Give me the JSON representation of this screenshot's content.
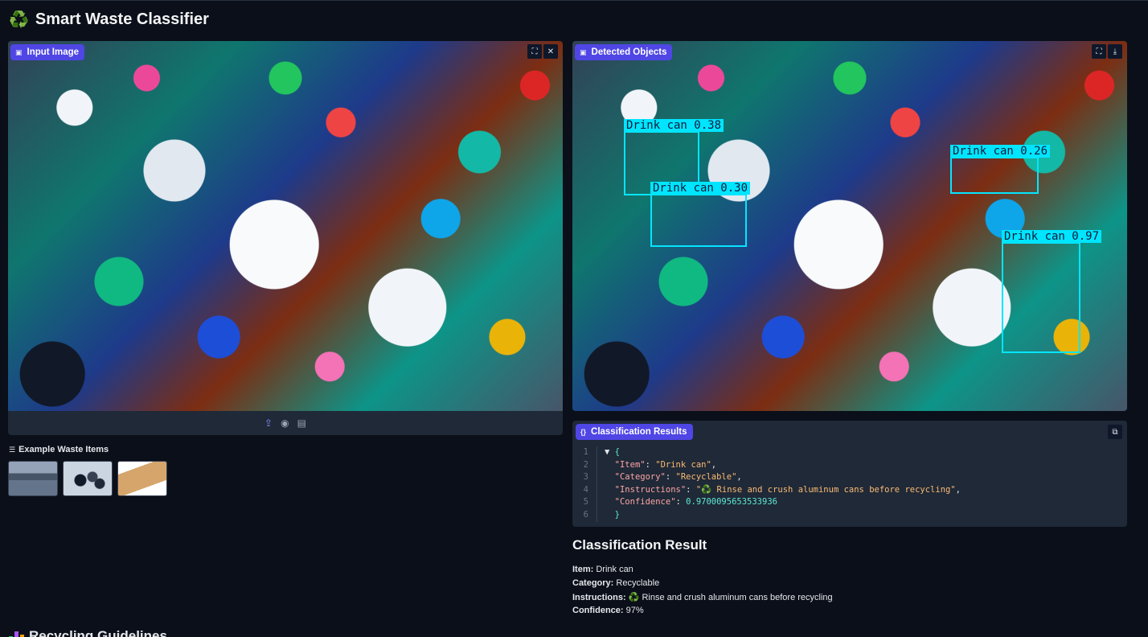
{
  "app": {
    "title": "Smart Waste Classifier",
    "title_icon": "♻️"
  },
  "input_panel": {
    "label": "Input Image",
    "tools": [
      "fullscreen-icon",
      "close-icon"
    ],
    "bottom_tools": [
      "upload-icon",
      "webcam-icon",
      "clipboard-icon"
    ]
  },
  "output_panel": {
    "label": "Detected Objects",
    "tools": [
      "fullscreen-icon",
      "download-icon"
    ],
    "detections": [
      {
        "label": "Drink can 0.38"
      },
      {
        "label": "Drink can 0.26"
      },
      {
        "label": "Drink can 0.30"
      },
      {
        "label": "Drink can 0.97"
      }
    ],
    "box_color": "#06e5ff"
  },
  "examples": {
    "title": "Example Waste Items",
    "items": [
      "beach waste",
      "batteries",
      "cardboard box"
    ]
  },
  "json_panel": {
    "label": "Classification Results",
    "lines": {
      "open": "{",
      "item_key": "\"Item\"",
      "item_val": "\"Drink can\"",
      "cat_key": "\"Category\"",
      "cat_val": "\"Recyclable\"",
      "ins_key": "\"Instructions\"",
      "ins_val": "\"♻️ Rinse and crush aluminum cans before recycling\"",
      "conf_key": "\"Confidence\"",
      "conf_val": "0.9700095653533936",
      "close": "}"
    }
  },
  "result": {
    "title": "Classification Result",
    "item_label": "Item:",
    "item_value": "Drink can",
    "category_label": "Category:",
    "category_value": "Recyclable",
    "instructions_label": "Instructions:",
    "instructions_value": "♻️  Rinse and crush aluminum cans before recycling",
    "confidence_label": "Confidence:",
    "confidence_value": "97%"
  },
  "guidelines": {
    "title": "Recycling Guidelines"
  },
  "colors": {
    "accent": "#4f46e5",
    "background": "#0b0f19",
    "panel": "#1f2937"
  }
}
